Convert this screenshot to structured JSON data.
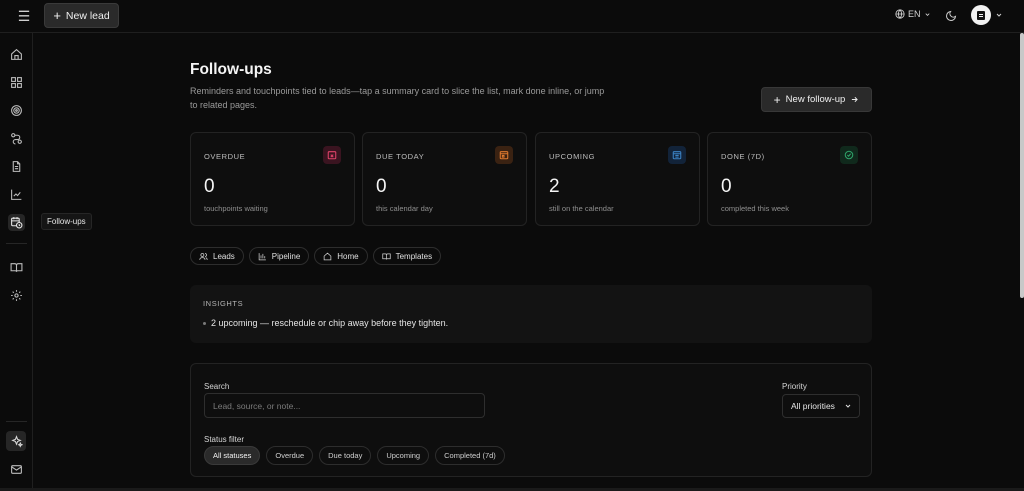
{
  "topbar": {
    "new_lead_label": "New lead",
    "language": "EN"
  },
  "sidebar": {
    "tooltip": "Follow-ups",
    "items": [
      {
        "name": "home-icon"
      },
      {
        "name": "dashboard-grid-icon"
      },
      {
        "name": "target-icon"
      },
      {
        "name": "pipeline-route-icon"
      },
      {
        "name": "document-icon"
      },
      {
        "name": "chart-line-icon"
      },
      {
        "name": "calendar-clock-icon",
        "active": true
      },
      {
        "name": "book-open-icon"
      },
      {
        "name": "gear-icon"
      },
      {
        "name": "sparkle-icon"
      },
      {
        "name": "mail-icon"
      }
    ]
  },
  "page": {
    "title": "Follow-ups",
    "subtitle": "Reminders and touchpoints tied to leads—tap a summary card to slice the list, mark done inline, or jump to related pages.",
    "new_followup_label": "New follow-up"
  },
  "cards": [
    {
      "label": "OVERDUE",
      "value": "0",
      "sub": "touchpoints waiting",
      "icon": "alert-calendar-icon",
      "color": "#e0436a",
      "bg": "#3a1420"
    },
    {
      "label": "DUE TODAY",
      "value": "0",
      "sub": "this calendar day",
      "icon": "calendar-today-icon",
      "color": "#e07a2e",
      "bg": "#3a2212"
    },
    {
      "label": "UPCOMING",
      "value": "2",
      "sub": "still on the calendar",
      "icon": "calendar-icon",
      "color": "#3b82c4",
      "bg": "#122339"
    },
    {
      "label": "DONE (7D)",
      "value": "0",
      "sub": "completed this week",
      "icon": "check-circle-icon",
      "color": "#2fa46a",
      "bg": "#10291c"
    }
  ],
  "quick_links": [
    {
      "label": "Leads",
      "icon": "users-icon"
    },
    {
      "label": "Pipeline",
      "icon": "bar-chart-icon"
    },
    {
      "label": "Home",
      "icon": "home-icon"
    },
    {
      "label": "Templates",
      "icon": "book-open-icon"
    }
  ],
  "insights": {
    "heading": "INSIGHTS",
    "line": "2 upcoming — reschedule or chip away before they tighten."
  },
  "filters": {
    "search_label": "Search",
    "search_placeholder": "Lead, source, or note...",
    "priority_label": "Priority",
    "priority_value": "All priorities",
    "status_label": "Status filter",
    "statuses": [
      "All statuses",
      "Overdue",
      "Due today",
      "Upcoming",
      "Completed (7d)"
    ],
    "active_status": "All statuses"
  }
}
